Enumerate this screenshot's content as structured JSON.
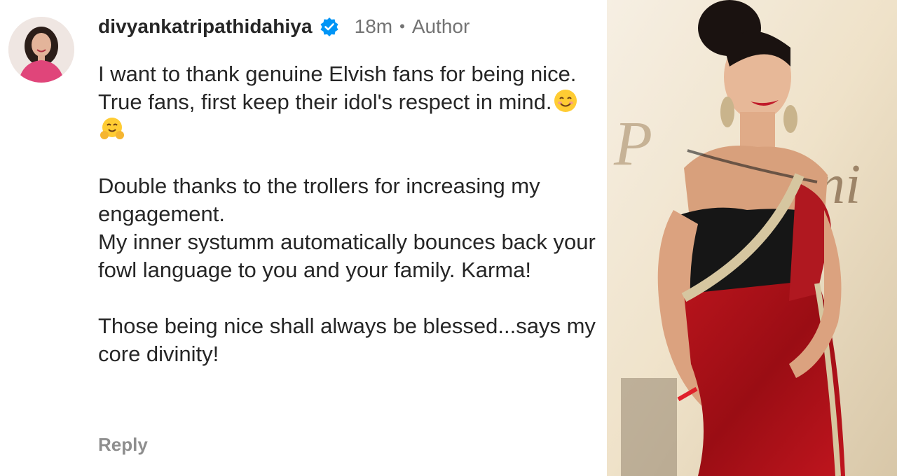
{
  "comment": {
    "username": "divyankatripathidahiya",
    "time": "18m",
    "separator": "•",
    "role_badge": "Author",
    "paragraphs": [
      "I want to thank genuine Elvish fans for being nice. True fans, first keep their idol's respect in mind.",
      "Double thanks to the trollers for increasing my engagement.\nMy inner systumm automatically bounces back your fowl language to you and your family. Karma!",
      "Those being nice shall always be blessed...says my core divinity!"
    ],
    "emojis": [
      "smiling-face-emoji",
      "hugging-face-emoji"
    ],
    "reply_label": "Reply"
  },
  "icons": {
    "verified": "verified-badge-icon"
  },
  "colors": {
    "text_primary": "#262626",
    "text_secondary": "#737373",
    "reply": "#8e8e8e",
    "verified_blue": "#0095f6"
  },
  "photo": {
    "description_label": "woman-in-red-saree"
  }
}
